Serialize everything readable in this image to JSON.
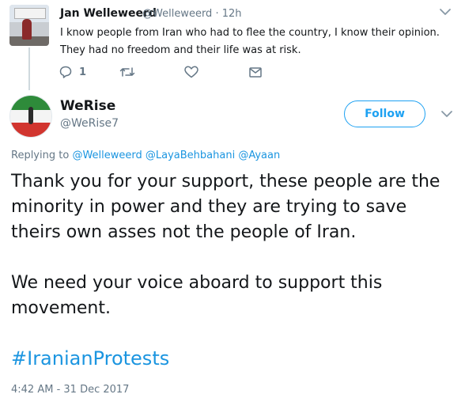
{
  "parent_tweet": {
    "author_name": "Jan Welleweerd",
    "meta": "@Welleweerd · 12h",
    "text": "I know people from Iran who had to flee the country, I know their opinion. They had no freedom and their life was at risk.",
    "reply_count": "1",
    "icons": [
      "reply-icon",
      "retweet-icon",
      "like-icon",
      "direct-message-icon",
      "chevron-down-icon"
    ]
  },
  "main_tweet": {
    "author_name": "WeRise",
    "handle": "@WeRise7",
    "follow_label": "Follow",
    "replying_to_prefix": "Replying to",
    "mentions": [
      "@Welleweerd",
      "@LayaBehbahani",
      "@Ayaan"
    ],
    "paragraph1": "Thank you for your support, these people are the minority in power and they are trying to save theirs own asses not the people of Iran.",
    "paragraph2": "We need your voice aboard to support this movement.",
    "hashtag": "#IranianProtests",
    "timestamp": "4:42 AM - 31 Dec 2017"
  },
  "colors": {
    "accent": "#1da1f2",
    "link": "#1b95e0",
    "muted": "#657786",
    "text": "#14171a"
  }
}
